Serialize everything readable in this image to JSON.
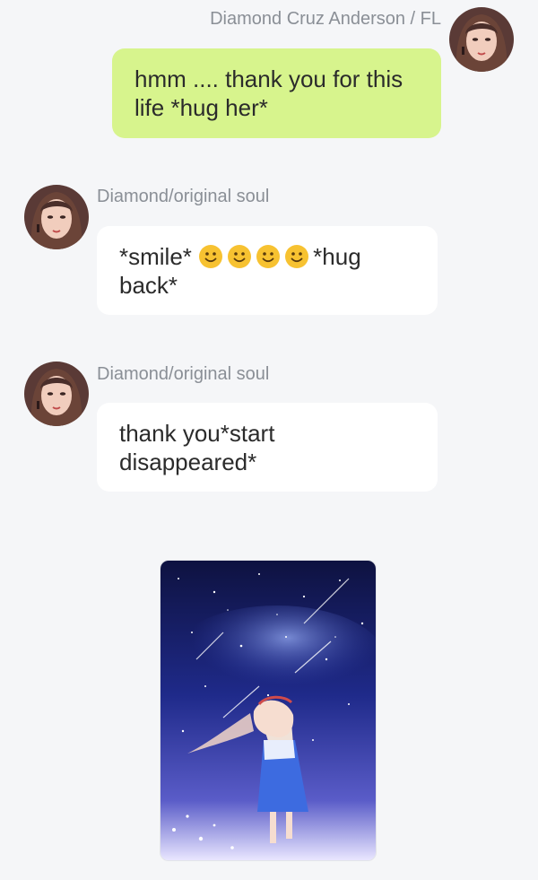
{
  "messages": [
    {
      "sender": "Diamond Cruz Anderson / FL",
      "direction": "outgoing",
      "lines": [
        "hmm .... thank you for this",
        "life *hug her*"
      ]
    },
    {
      "sender": "Diamond/original soul",
      "direction": "incoming",
      "text_before": "*smile*",
      "emojis": [
        "slightly-smiling-face",
        "slightly-smiling-face",
        "slightly-smiling-face",
        "slightly-smiling-face"
      ],
      "text_after": "*hug",
      "line2": "back*"
    },
    {
      "sender": "Diamond/original soul",
      "direction": "incoming",
      "lines": [
        "thank you*start",
        "disappeared*"
      ]
    },
    {
      "attachment": "image",
      "description_icon": "starry-night-girl-illustration"
    }
  ],
  "colors": {
    "background": "#f5f6f8",
    "outgoing_bubble": "#d7f48d",
    "incoming_bubble": "#ffffff",
    "sender_name": "#8a8f96",
    "message_text": "#2b2b2b"
  }
}
